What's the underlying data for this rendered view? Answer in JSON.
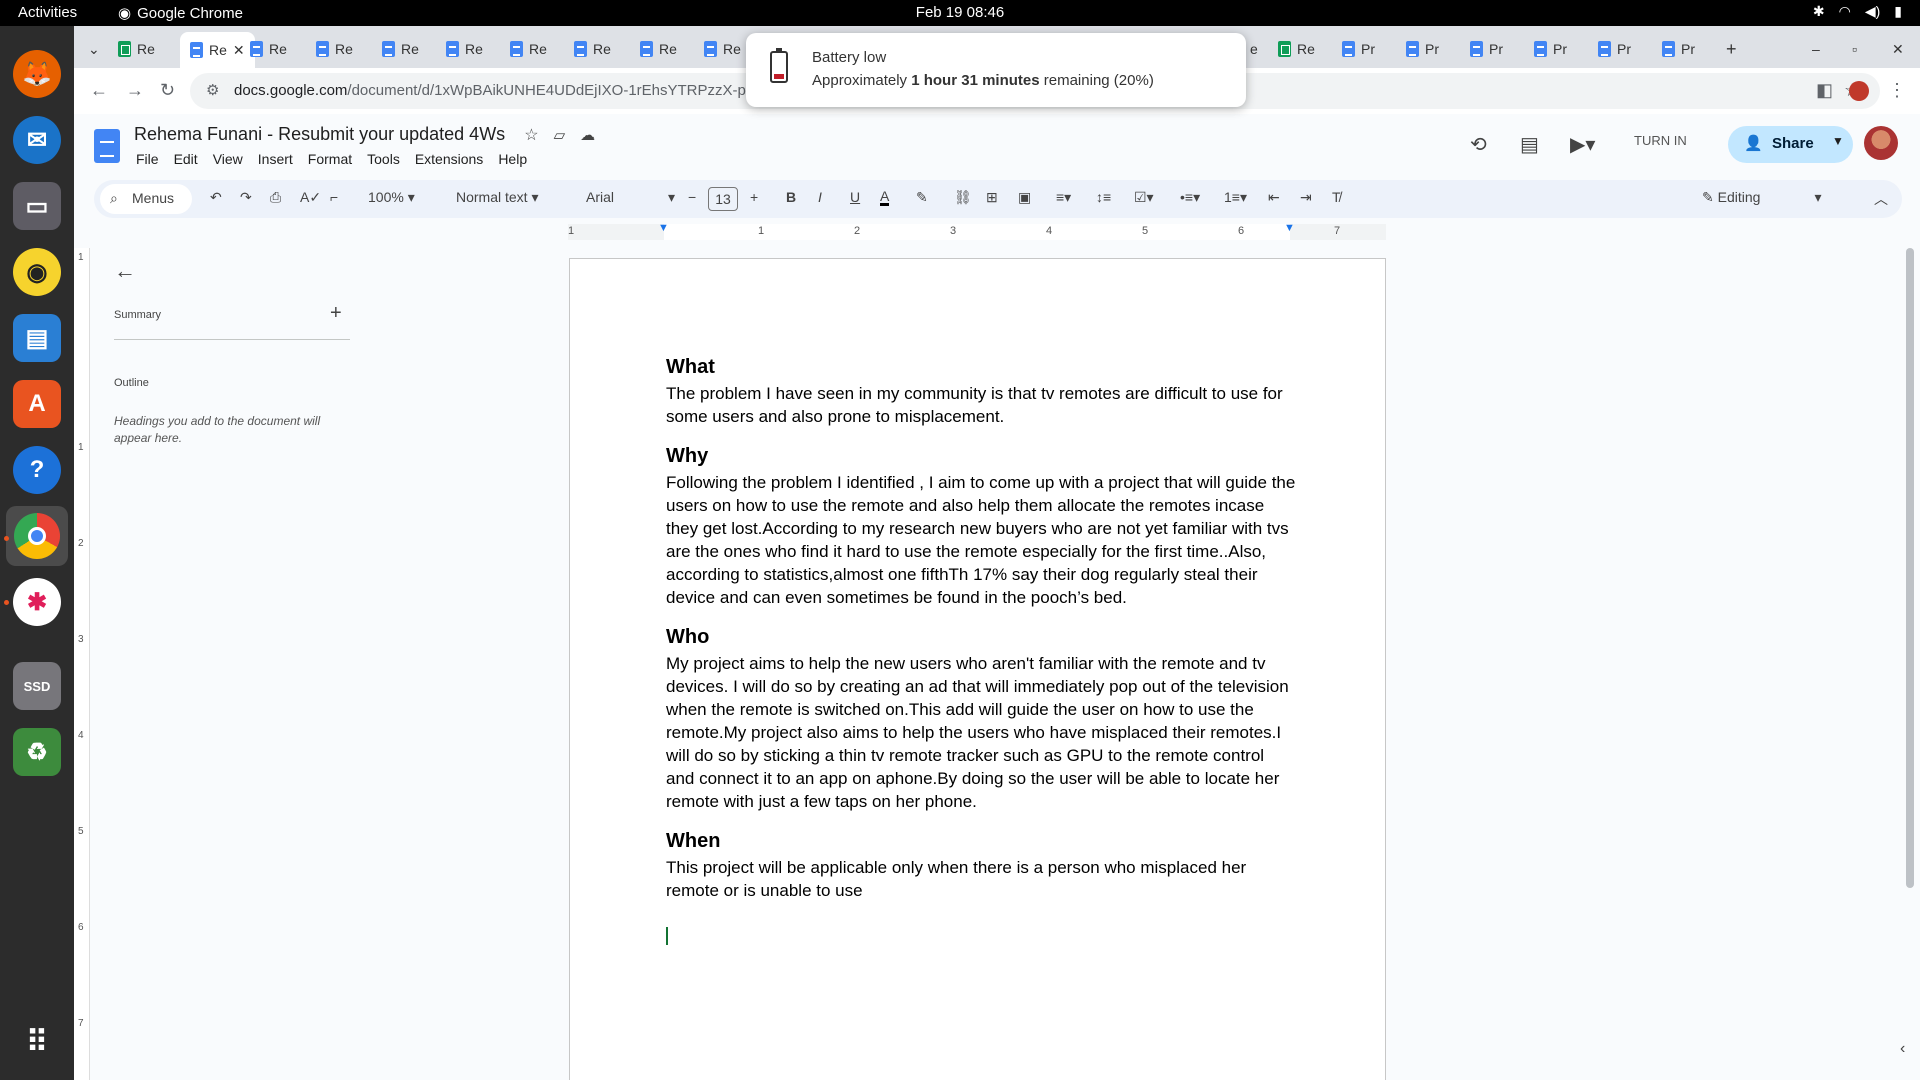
{
  "topbar": {
    "activities": "Activities",
    "app_name": "Google Chrome",
    "clock": "Feb 19  08:46"
  },
  "dock": {
    "items": [
      "firefox-icon",
      "thunderbird-icon",
      "files-icon",
      "rhythmbox-icon",
      "libreoffice-writer-icon",
      "app-center-icon",
      "help-icon",
      "chrome-icon",
      "slack-icon",
      "ssd-drive-icon",
      "trash-icon",
      "show-apps-icon"
    ],
    "ssd_label": "SSD"
  },
  "browser": {
    "tabs_left": [
      "Re",
      "Re",
      "Re",
      "Re",
      "Re",
      "Re",
      "Re",
      "Re",
      "Re",
      "Re"
    ],
    "tabs_right": [
      "e",
      "Re",
      "Pr",
      "Pr",
      "Pr",
      "Pr",
      "Pr",
      "Pr"
    ],
    "url_host": "docs.google.com",
    "url_path": "/document/d/1xWpBAikUNHE4UDdEjIXO-1rEhsYTRPzzX-pbl8_7T"
  },
  "notification": {
    "title": "Battery low",
    "body_prefix": "Approximately ",
    "body_bold": "1 hour 31 minutes",
    "body_suffix": " remaining (20%)"
  },
  "docs": {
    "title": "Rehema Funani - Resubmit your updated 4Ws",
    "menu": [
      "File",
      "Edit",
      "View",
      "Insert",
      "Format",
      "Tools",
      "Extensions",
      "Help"
    ],
    "turn_in": "TURN IN",
    "share": "Share"
  },
  "toolbar": {
    "menus": "Menus",
    "zoom": "100%",
    "style": "Normal text",
    "font": "Arial",
    "font_size": "13",
    "mode": "Editing"
  },
  "ruler": {
    "marks": [
      "1",
      "1",
      "2",
      "3",
      "4",
      "5",
      "6",
      "7"
    ],
    "vmarks": [
      "1",
      "1",
      "2",
      "3",
      "4",
      "5",
      "6",
      "7"
    ]
  },
  "outline": {
    "summary": "Summary",
    "outline": "Outline",
    "hint": "Headings you add to the document will appear here."
  },
  "document": {
    "sections": [
      {
        "heading": "What",
        "body": "The problem I have seen in my community is that  tv remotes are difficult to use for some users and also prone to misplacement."
      },
      {
        "heading": "Why",
        "body": "Following the problem I identified , I aim to come up with a project that will guide the users on how to use the remote and also help them allocate the remotes incase they get lost.According to my research new buyers who are not yet familiar with tvs are the ones who find it hard to use the remote especially for the first time..Also, according to statistics,almost one fifthTh 17% say their dog regularly steal their device and can even sometimes be found in the pooch’s bed."
      },
      {
        "heading": "Who",
        "body": "My project aims to help the new users who aren't familiar with the remote and tv devices. I will do so by creating an ad that will immediately pop out of the television when the remote is switched on.This add will guide the user on how to use the remote.My project also aims to help the users who have misplaced their remotes.I will do so by sticking a thin tv remote tracker such as GPU to the remote control and connect it to an app on aphone.By doing so the user will be able to locate her remote with just a few taps on her phone."
      },
      {
        "heading": "When",
        "body": "This project will be applicable only when there is a person who misplaced her remote or is unable to use"
      }
    ]
  }
}
